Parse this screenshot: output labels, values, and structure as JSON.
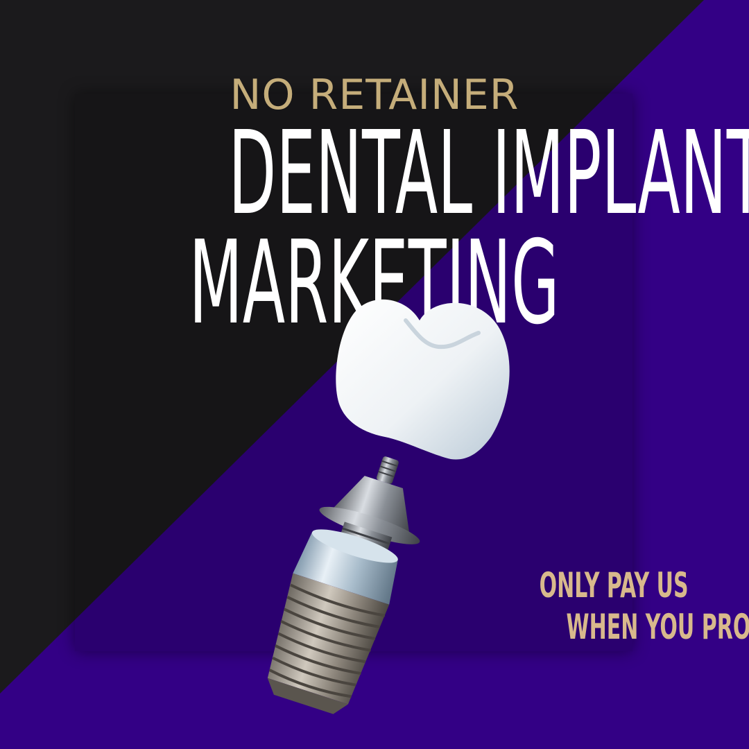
{
  "ad": {
    "kicker": "NO RETAINER",
    "headline_line1": "DENTAL IMPLANT",
    "headline_line2": "MARKETING",
    "promo_line1": "ONLY PAY US",
    "promo_line2": "WHEN YOU PROFIT!"
  },
  "colors": {
    "background_dark": "#1b1a1c",
    "background_purple": "#330085",
    "kicker_gold": "#c5ad7a",
    "headline_white": "#ffffff",
    "promo_gold": "#d8b98c"
  },
  "illustration": {
    "subject": "dental-implant-with-crown"
  }
}
